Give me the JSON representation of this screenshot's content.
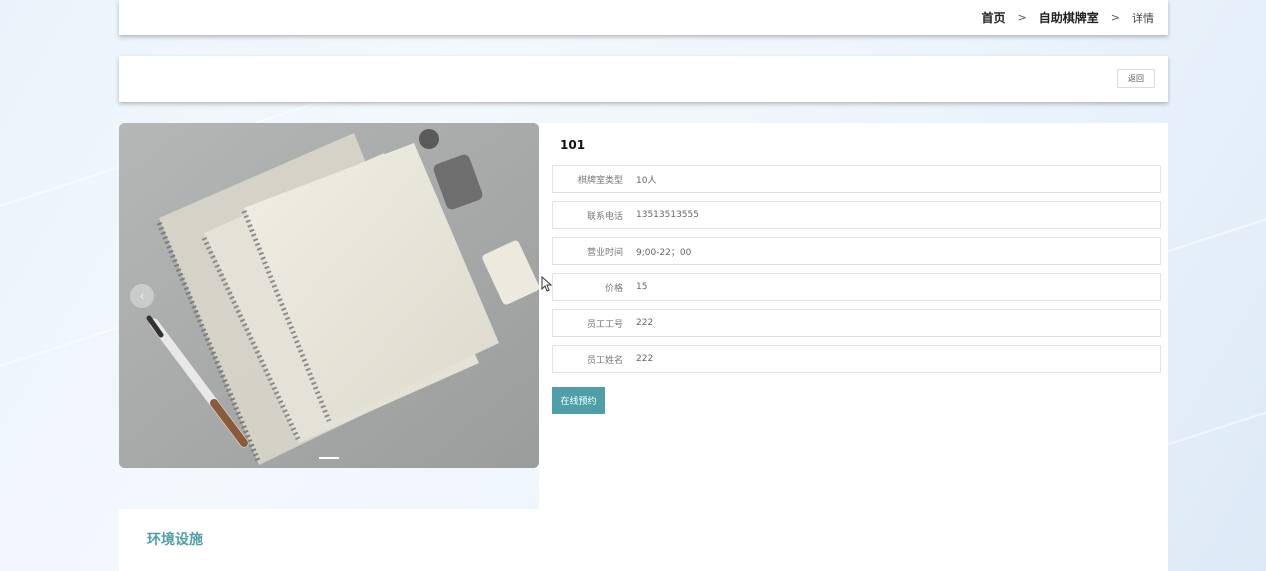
{
  "breadcrumb": {
    "home": "首页",
    "separator": ">",
    "category": "自助棋牌室",
    "current": "详情"
  },
  "actions": {
    "back_label": "返回"
  },
  "room": {
    "title": "101",
    "fields": [
      {
        "label": "棋牌室类型",
        "value": "10人"
      },
      {
        "label": "联系电话",
        "value": "13513513555"
      },
      {
        "label": "营业时间",
        "value": "9;00-22；00"
      },
      {
        "label": "价格",
        "value": "15"
      },
      {
        "label": "员工工号",
        "value": "222"
      },
      {
        "label": "员工姓名",
        "value": "222"
      }
    ],
    "reserve_label": "在线预约"
  },
  "carousel": {
    "prev_icon": "‹",
    "next_icon": "›"
  },
  "environment": {
    "title": "环境设施"
  },
  "colors": {
    "accent": "#4e9fa7"
  }
}
